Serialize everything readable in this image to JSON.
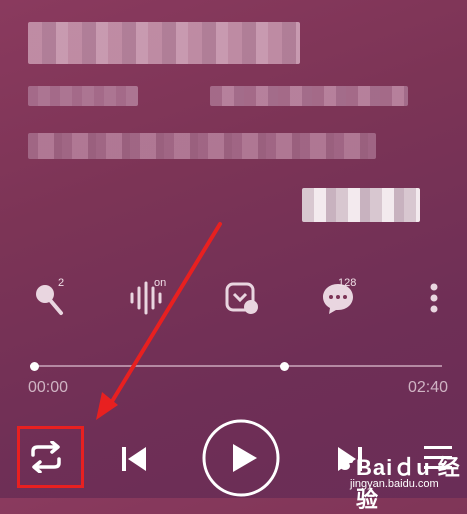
{
  "player": {
    "time_current": "00:00",
    "time_total": "02:40",
    "progress": 0.0,
    "buffer": 0.62,
    "badges": {
      "sing": "2",
      "effect": "on",
      "comments": "128"
    },
    "icons": {
      "sing": "microphone-icon",
      "effect": "sound-effect-icon",
      "download": "download-icon",
      "comments": "comment-icon",
      "more": "more-vertical-icon",
      "repeat": "repeat-icon",
      "prev": "skip-previous-icon",
      "play": "play-icon",
      "next": "skip-next-icon",
      "playlist": "playlist-icon"
    }
  },
  "watermark": {
    "brand": "Baiｄu 经验",
    "url": "jingyan.baidu.com"
  },
  "colors": {
    "background": "#7c3456",
    "annotation": "#e82020",
    "icon": "#e9d6e0"
  }
}
